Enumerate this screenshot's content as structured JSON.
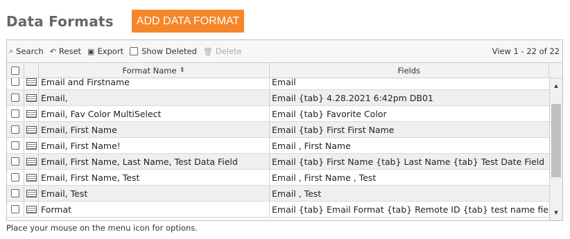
{
  "page": {
    "title": "Data Formats",
    "add_button": "ADD DATA FORMAT"
  },
  "toolbar": {
    "search": "Search",
    "reset": "Reset",
    "export": "Export",
    "show_deleted": "Show Deleted",
    "delete": "Delete",
    "view_info": "View 1 - 22 of 22"
  },
  "table": {
    "headers": {
      "format_name": "Format Name",
      "fields": "Fields"
    },
    "sort_indicator": "⬍",
    "rows": [
      {
        "name": "Email and Firstname",
        "fields": " Email"
      },
      {
        "name": "Email,",
        "fields": "Email {tab} 4.28.2021 6:42pm DB01"
      },
      {
        "name": "Email, Fav Color MultiSelect",
        "fields": "Email {tab} Favorite Color"
      },
      {
        "name": "Email, First Name",
        "fields": " Email {tab} First First Name"
      },
      {
        "name": "Email, First Name!",
        "fields": "Email , First Name"
      },
      {
        "name": "Email, First Name, Last Name, Test Data Field",
        "fields": "Email {tab} First Name {tab} Last Name {tab} Test Date Field"
      },
      {
        "name": "Email, First Name, Test",
        "fields": "Email , First Name , Test"
      },
      {
        "name": "Email, Test",
        "fields": " Email , Test"
      },
      {
        "name": "Format",
        "fields": " Email {tab} Email Format {tab} Remote ID {tab} test name field"
      }
    ]
  },
  "footer": {
    "note": "Place your mouse on the menu icon for options."
  },
  "icons": {
    "search": "⌕",
    "reset": "↶",
    "export": "▣",
    "delete": "🗑",
    "scroll_up": "▲",
    "scroll_down": "▼"
  },
  "colors": {
    "accent": "#f5862a",
    "title": "#666666",
    "alt_row": "#efefef"
  }
}
